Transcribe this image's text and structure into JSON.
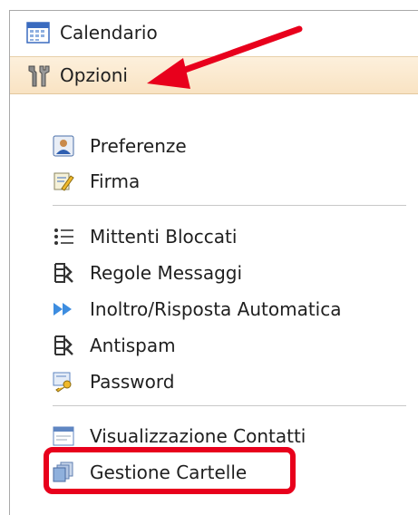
{
  "nav": {
    "calendar": {
      "label": "Calendario",
      "icon": "calendar-icon"
    },
    "options": {
      "label": "Opzioni",
      "icon": "tools-icon",
      "selected": true
    }
  },
  "options_menu": {
    "group1": [
      {
        "label": "Preferenze",
        "icon": "user-profile-icon"
      },
      {
        "label": "Firma",
        "icon": "signature-pen-icon"
      }
    ],
    "group2": [
      {
        "label": "Mittenti Bloccati",
        "icon": "list-icon"
      },
      {
        "label": "Regole Messaggi",
        "icon": "rules-icon"
      },
      {
        "label": "Inoltro/Risposta Automatica",
        "icon": "forward-icon"
      },
      {
        "label": "Antispam",
        "icon": "rules-icon"
      },
      {
        "label": "Password",
        "icon": "key-icon"
      }
    ],
    "group3": [
      {
        "label": "Visualizzazione Contatti",
        "icon": "window-icon"
      },
      {
        "label": "Gestione Cartelle",
        "icon": "folders-icon",
        "highlighted": true
      }
    ]
  },
  "colors": {
    "selected_row": "#f9e3c3",
    "annotation_red": "#e8001c"
  }
}
